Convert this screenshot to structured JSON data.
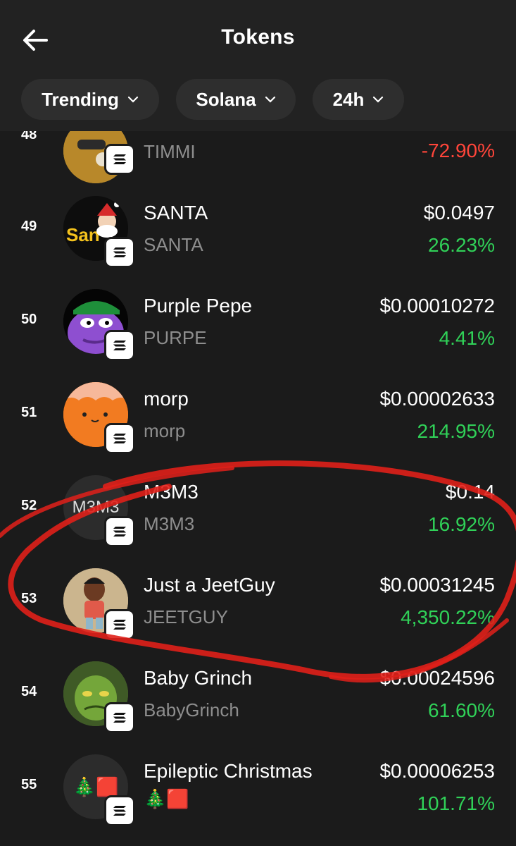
{
  "header": {
    "title": "Tokens",
    "filters": [
      {
        "label": "Trending"
      },
      {
        "label": "Solana"
      },
      {
        "label": "24h"
      }
    ]
  },
  "tokens": [
    {
      "rank": "48",
      "name": "",
      "symbol": "TIMMI",
      "price": "",
      "change": "-72.90%",
      "direction": "down"
    },
    {
      "rank": "49",
      "name": "SANTA",
      "symbol": "SANTA",
      "price": "$0.0497",
      "change": "26.23%",
      "direction": "up"
    },
    {
      "rank": "50",
      "name": "Purple Pepe",
      "symbol": "PURPE",
      "price": "$0.00010272",
      "change": "4.41%",
      "direction": "up"
    },
    {
      "rank": "51",
      "name": "morp",
      "symbol": "morp",
      "price": "$0.00002633",
      "change": "214.95%",
      "direction": "up"
    },
    {
      "rank": "52",
      "name": "M3M3",
      "symbol": "M3M3",
      "price": "$0.14",
      "change": "16.92%",
      "direction": "up",
      "avatar_text": "M3M3"
    },
    {
      "rank": "53",
      "name": "Just a JeetGuy",
      "symbol": "JEETGUY",
      "price": "$0.00031245",
      "change": "4,350.22%",
      "direction": "up"
    },
    {
      "rank": "54",
      "name": "Baby Grinch",
      "symbol": "BabyGrinch",
      "price": "$0.00024596",
      "change": "61.60%",
      "direction": "up"
    },
    {
      "rank": "55",
      "name": "Epileptic Christmas",
      "symbol": "🎄🟥",
      "price": "$0.00006253",
      "change": "101.71%",
      "direction": "up",
      "avatar_text": "🎄🟥"
    }
  ],
  "colors": {
    "background": "#1b1b1b",
    "header": "#222222",
    "positive": "#30d158",
    "negative": "#ff453a",
    "annotation": "#e0201a"
  },
  "icons": {
    "back": "arrow-left-icon",
    "filter_dropdown": "chevron-down-icon",
    "chain_badge": "solana-icon"
  }
}
